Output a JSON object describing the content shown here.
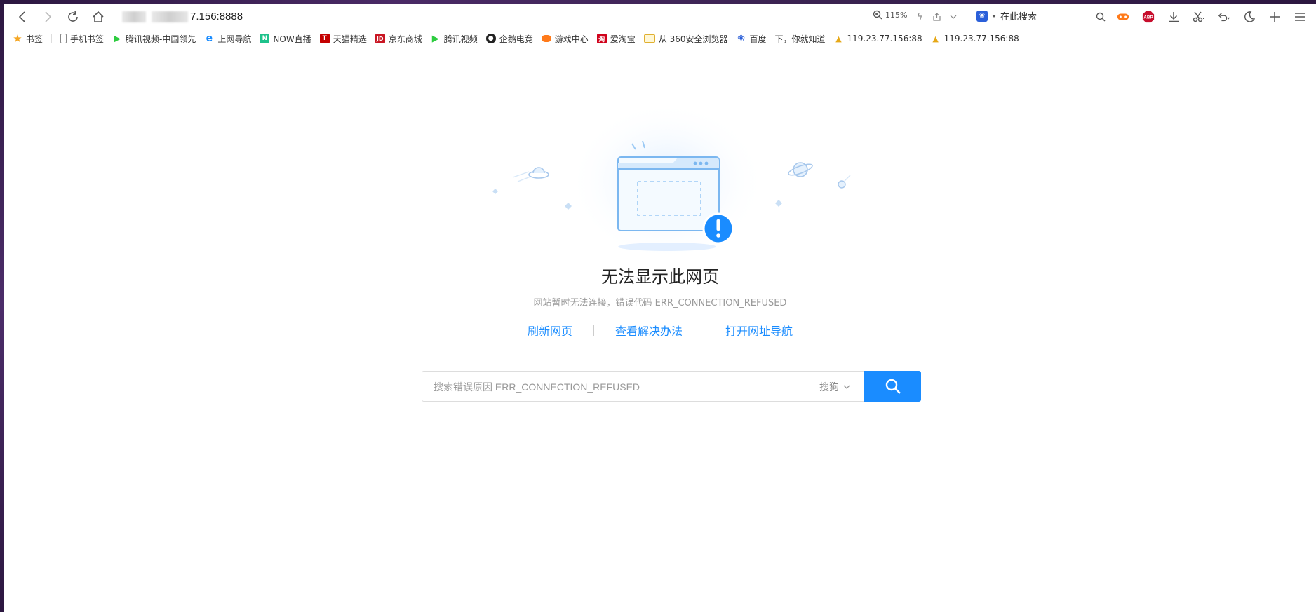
{
  "address_bar": {
    "url": "7.156:8888"
  },
  "toolbar": {
    "zoom_level": "115%",
    "search_engine_label": "在此搜索",
    "adblock_badge": "ABP"
  },
  "bookmarks": [
    {
      "label": "书签",
      "icon": "star-icon",
      "color": "#f5a623"
    },
    {
      "label": "手机书签",
      "icon": "phone-icon",
      "color": "#888888"
    },
    {
      "label": "腾讯视频-中国领先",
      "icon": "tencent-video-icon",
      "color": "#2ecc40"
    },
    {
      "label": "上网导航",
      "icon": "ie-icon",
      "color": "#1a8cff"
    },
    {
      "label": "NOW直播",
      "icon": "now-live-icon",
      "color": "#1ec28b"
    },
    {
      "label": "天猫精选",
      "icon": "tmall-icon",
      "color": "#c40000"
    },
    {
      "label": "京东商城",
      "icon": "jd-icon",
      "color": "#c91623"
    },
    {
      "label": "腾讯视频",
      "icon": "tencent-video-icon",
      "color": "#2ecc40"
    },
    {
      "label": "企鹅电竞",
      "icon": "penguin-esports-icon",
      "color": "#222222"
    },
    {
      "label": "游戏中心",
      "icon": "gamepad-icon",
      "color": "#ff7a1a"
    },
    {
      "label": "爱淘宝",
      "icon": "taobao-icon",
      "color": "#d0021b"
    },
    {
      "label": "从 360安全浏览器",
      "icon": "folder-icon",
      "color": "#f5c242"
    },
    {
      "label": "百度一下，你就知道",
      "icon": "baidu-paw-icon",
      "color": "#2b5fd9"
    },
    {
      "label": "119.23.77.156:88",
      "icon": "pma-icon",
      "color": "#e6a817"
    },
    {
      "label": "119.23.77.156:88",
      "icon": "pma-icon",
      "color": "#e6a817"
    }
  ],
  "error_page": {
    "title": "无法显示此网页",
    "subtitle": "网站暂时无法连接，错误代码 ERR_CONNECTION_REFUSED",
    "actions": [
      "刷新网页",
      "查看解决办法",
      "打开网址导航"
    ],
    "search_placeholder": "搜索错误原因 ERR_CONNECTION_REFUSED",
    "search_engine": "搜狗",
    "accent_color": "#1a8cff"
  }
}
